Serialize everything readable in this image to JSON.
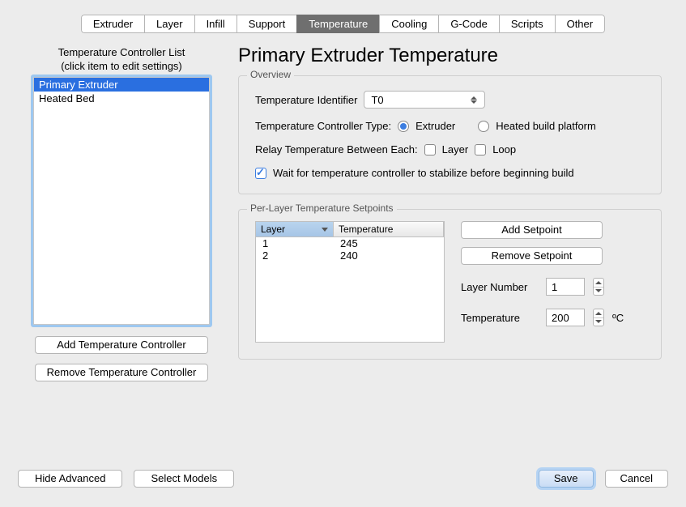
{
  "tabs": [
    "Extruder",
    "Layer",
    "Infill",
    "Support",
    "Temperature",
    "Cooling",
    "G-Code",
    "Scripts",
    "Other"
  ],
  "active_tab": "Temperature",
  "left": {
    "title_line1": "Temperature Controller List",
    "title_line2": "(click item to edit settings)",
    "items": [
      "Primary Extruder",
      "Heated Bed"
    ],
    "selected": "Primary Extruder",
    "add_btn": "Add Temperature Controller",
    "remove_btn": "Remove Temperature Controller"
  },
  "page_title": "Primary Extruder Temperature",
  "overview": {
    "group_title": "Overview",
    "id_label": "Temperature Identifier",
    "id_value": "T0",
    "type_label": "Temperature Controller Type:",
    "type_extruder": "Extruder",
    "type_heated": "Heated build platform",
    "relay_label": "Relay Temperature Between Each:",
    "relay_layer": "Layer",
    "relay_loop": "Loop",
    "wait_label": "Wait for temperature controller to stabilize before beginning build"
  },
  "setpoints": {
    "group_title": "Per-Layer Temperature Setpoints",
    "col_layer": "Layer",
    "col_temp": "Temperature",
    "rows": [
      {
        "layer": "1",
        "temp": "245"
      },
      {
        "layer": "2",
        "temp": "240"
      }
    ],
    "add_btn": "Add Setpoint",
    "remove_btn": "Remove Setpoint",
    "layer_num_label": "Layer Number",
    "layer_num_value": "1",
    "temp_label": "Temperature",
    "temp_value": "200",
    "temp_unit": "ºC"
  },
  "footer": {
    "hide_advanced": "Hide Advanced",
    "select_models": "Select Models",
    "save": "Save",
    "cancel": "Cancel"
  }
}
